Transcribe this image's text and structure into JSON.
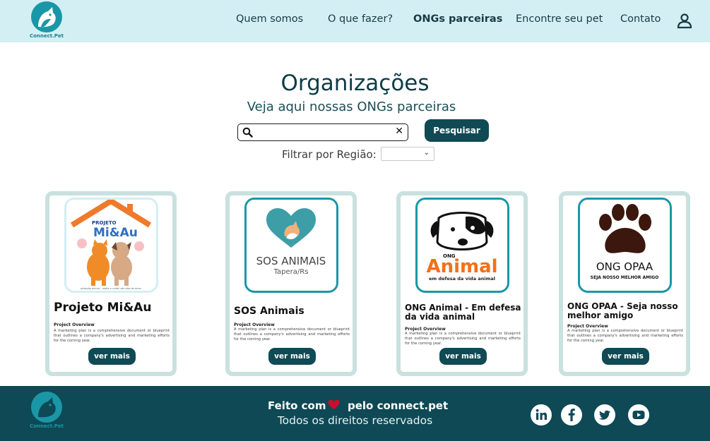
{
  "brand": {
    "name": "Connect.Pet"
  },
  "nav": {
    "items": [
      {
        "label": "Quem somos",
        "active": false
      },
      {
        "label": "O que fazer?",
        "active": false
      },
      {
        "label": "ONGs parceiras",
        "active": true
      },
      {
        "label": "Encontre seu pet",
        "active": false
      },
      {
        "label": "Contato",
        "active": false
      }
    ],
    "user_icon": "user-icon"
  },
  "main": {
    "title": "Organizações",
    "subtitle": "Veja aqui nossas ONGs parceiras",
    "search": {
      "value": "",
      "placeholder": "",
      "button_label": "Pesquisar",
      "icon": "search-icon",
      "clear_icon": "close-icon"
    },
    "filter": {
      "label": "Filtrar por Região:",
      "value": ""
    }
  },
  "cards": [
    {
      "title": "Projeto Mi&Au",
      "overview_label": "Project Overview",
      "description": "A marketing plan is a comprehensive document or blueprint that outlines a company's advertising and marketing efforts for the coming year.",
      "button_label": "ver mais",
      "logo_lines": [
        "PROJETO",
        "Mi&Au"
      ],
      "logo_caption": "proteção animal - adote e cuide! são atos de amor"
    },
    {
      "title": "SOS Animais",
      "overview_label": "Project Overview",
      "description": "A marketing plan is a comprehensive document or blueprint that outlines a company's advertising and marketing efforts for the coming year.",
      "button_label": "ver mais",
      "logo_lines": [
        "SOS ANIMAIS",
        "Tapera/Rs"
      ]
    },
    {
      "title": "ONG Animal - Em defesa da vida animal",
      "overview_label": "Project Overview",
      "description": "A marketing plan is a comprehensive document or blueprint that outlines a company's advertising and marketing efforts for the coming year.",
      "button_label": "ver mais",
      "logo_lines": [
        "ONG",
        "Animal",
        "em defesa da vida animal"
      ]
    },
    {
      "title": "ONG OPAA - Seja nosso melhor amigo",
      "overview_label": "Project Overview",
      "description": "A marketing plan is a comprehensive document or blueprint that outlines a company's advertising and marketing efforts for the coming year.",
      "button_label": "ver mais",
      "logo_lines": [
        "ONG OPAA",
        "SEJA NOSSO MELHOR AMIGO"
      ]
    }
  ],
  "footer": {
    "made_prefix": "Feito com",
    "made_suffix": "pelo connect.pet",
    "rights": "Todos os direitos reservados",
    "social": [
      "linkedin-icon",
      "facebook-icon",
      "twitter-icon",
      "youtube-icon"
    ]
  },
  "colors": {
    "header_bg": "#d4eff4",
    "primary": "#0f4a55",
    "accent": "#1a97a6",
    "card_border": "#c9e1df",
    "heart": "#c8102e"
  }
}
